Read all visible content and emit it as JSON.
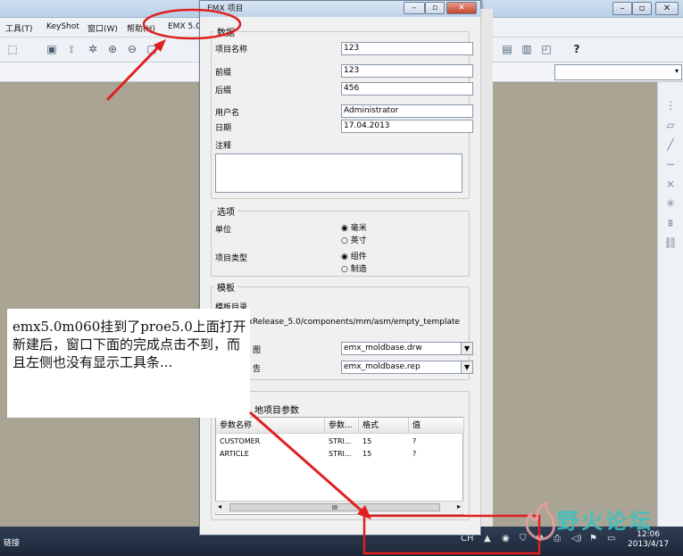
{
  "menubar": {
    "items": [
      "工具(T)",
      "KeyShot",
      "窗口(W)",
      "帮助(H)",
      "EMX 5.0"
    ]
  },
  "dialog": {
    "title": "EMX 项目",
    "data_group": {
      "label": "数据",
      "project_name_label": "项目名称",
      "project_name_value": "123",
      "prefix_label": "前缀",
      "prefix_value": "123",
      "suffix_label": "后缀",
      "suffix_value": "456",
      "username_label": "用户名",
      "username_value": "Administrator",
      "date_label": "日期",
      "date_value": "17.04.2013",
      "comment_label": "注释",
      "comment_value": ""
    },
    "options_group": {
      "label": "选项",
      "unit_label": "单位",
      "unit_options": [
        "毫米",
        "英寸"
      ],
      "unit_selected": "毫米",
      "type_label": "项目类型",
      "type_options": [
        "组件",
        "制造"
      ],
      "type_selected": "组件"
    },
    "template_group": {
      "label": "模板",
      "dir_label": "模板目录",
      "dir_value": "060\\emxRelease_5.0/components/mm/asm/empty_template",
      "drawing_label": "图",
      "drawing_value": "emx_moldbase.drw",
      "report_label": "告",
      "report_value": "emx_moldbase.rep"
    },
    "params_group": {
      "label": "地项目参数",
      "columns": [
        "参数名称",
        "参数...",
        "格式",
        "值"
      ],
      "rows": [
        [
          "CUSTOMER",
          "STRI...",
          "15",
          "?"
        ],
        [
          "ARTICLE",
          "STRI...",
          "15",
          "?"
        ]
      ],
      "scroll_mark": "III"
    }
  },
  "note": {
    "text": "emx5.0m060挂到了proe5.0上面打开新建后，窗口下面的完成点击不到，而且左侧也没有显示工具条..."
  },
  "statusbar": {
    "label": "链接",
    "ime": "CH",
    "clock_time": "12:06",
    "clock_date": "2013/4/17"
  },
  "watermark": {
    "text": "野火论坛"
  },
  "colors": {
    "annotation_red": "#e02020",
    "canvas": "#a9a493"
  }
}
